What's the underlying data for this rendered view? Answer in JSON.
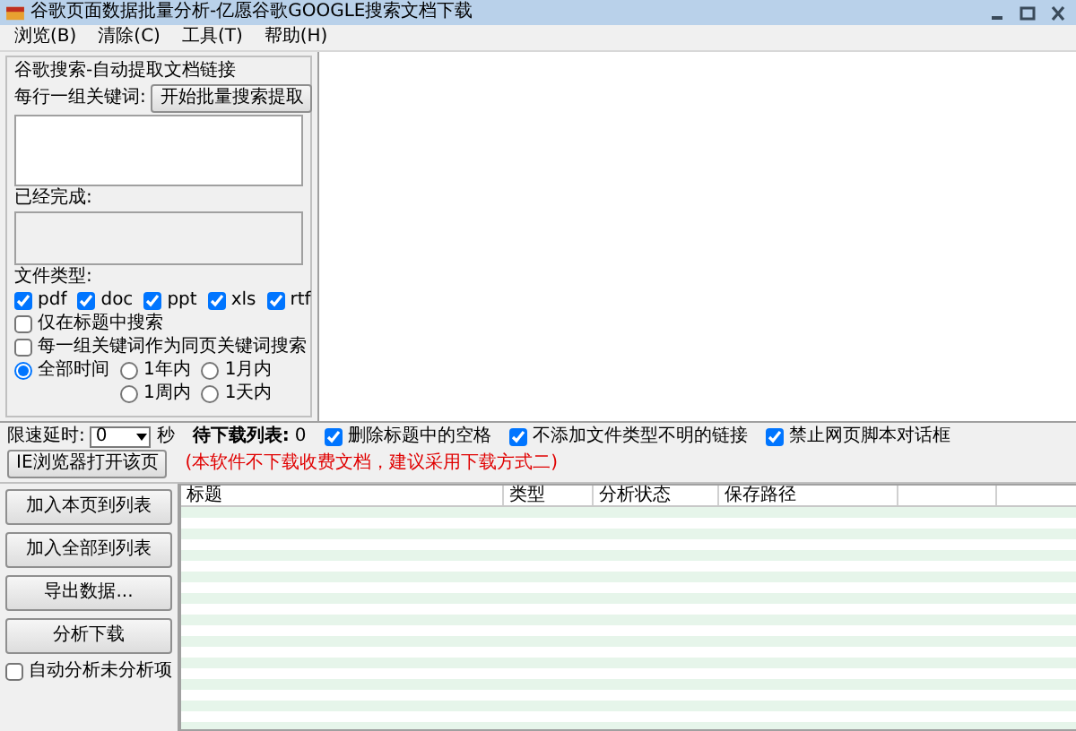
{
  "window": {
    "title": "谷歌页面数据批量分析-亿愿谷歌GOOGLE搜索文档下载"
  },
  "menu": [
    {
      "label": "浏览(B)"
    },
    {
      "label": "清除(C)"
    },
    {
      "label": "工具(T)"
    },
    {
      "label": "帮助(H)"
    }
  ],
  "search_group": {
    "title": "谷歌搜索-自动提取文档链接",
    "keywords_label": "每行一组关键词:",
    "start_button": "开始批量搜索提取",
    "done_label": "已经完成:",
    "done_disabled": true,
    "file_types_label": "文件类型:",
    "file_types": [
      {
        "label": "pdf",
        "checked": true
      },
      {
        "label": "doc",
        "checked": true
      },
      {
        "label": "ppt",
        "checked": true
      },
      {
        "label": "xls",
        "checked": true
      },
      {
        "label": "rtf",
        "checked": true
      }
    ],
    "options": [
      {
        "label": "仅在标题中搜索",
        "checked": false
      },
      {
        "label": "每一组关键词作为同页关键词搜索",
        "checked": false
      }
    ],
    "time_ranges": [
      {
        "label": "全部时间",
        "selected": true
      },
      {
        "label": "1年内",
        "selected": false
      },
      {
        "label": "1月内",
        "selected": false
      },
      {
        "label": "1周内",
        "selected": false
      },
      {
        "label": "1天内",
        "selected": false
      }
    ]
  },
  "toolbar": {
    "delay_label": "限速延时:",
    "delay_value": "0",
    "delay_unit": "秒",
    "queue_label": "待下载列表:",
    "queue_count": "0",
    "options": [
      {
        "label": "删除标题中的空格",
        "checked": true
      },
      {
        "label": "不添加文件类型不明的链接",
        "checked": true
      },
      {
        "label": "禁止网页脚本对话框",
        "checked": true
      }
    ],
    "ie_button": "IE浏览器打开该页",
    "notice": "(本软件不下载收费文档，建议采用下载方式二)"
  },
  "actions": [
    "加入本页到列表",
    "加入全部到列表",
    "导出数据...",
    "分析下载"
  ],
  "auto_analyze": {
    "label": "自动分析未分析项",
    "checked": false
  },
  "table": {
    "columns": [
      "标题",
      "类型",
      "分析状态",
      "保存路径"
    ]
  }
}
